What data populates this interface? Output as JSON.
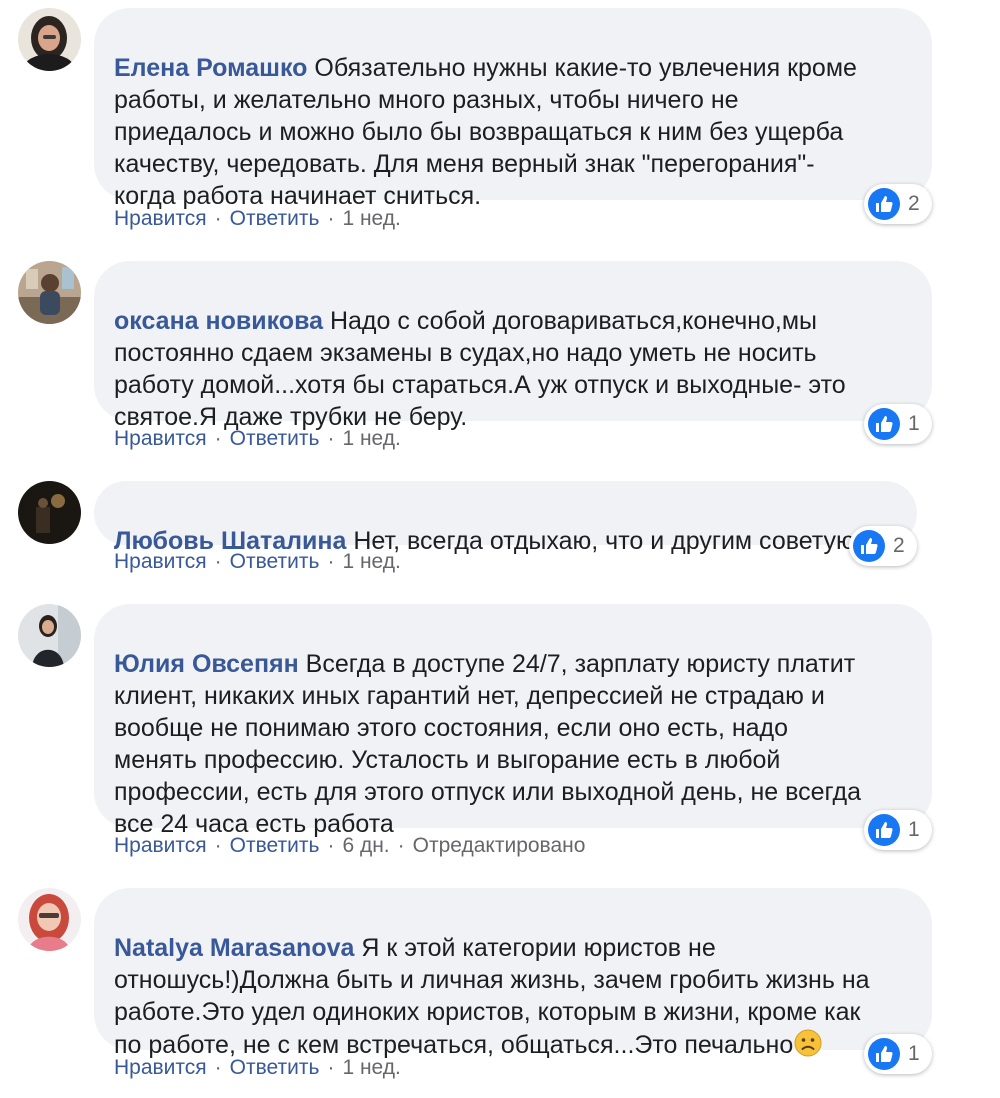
{
  "comments": [
    {
      "author": "Елена Ромашко",
      "text": " Обязательно нужны какие-то увлечения кроме\nработы, и желательно много разных, чтобы ничего не\nприедалось и можно было бы возвращаться к ним без ущерба\nкачеству, чередовать. Для меня верный знак \"перегорания\"-\nкогда работа начинает сниться.",
      "like_label": "Нравится",
      "reply_label": "Ответить",
      "time": "1 нед.",
      "reactions": "2"
    },
    {
      "author": "оксана новикова",
      "text": " Надо с собой договариваться,конечно,мы\nпостоянно сдаем экзамены в судах,но надо уметь не носить\nработу домой...хотя бы стараться.А уж отпуск и выходные- это\nсвятое.Я даже трубки не беру.",
      "like_label": "Нравится",
      "reply_label": "Ответить",
      "time": "1 нед.",
      "reactions": "1"
    },
    {
      "author": "Любовь Шаталина",
      "text": " Нет, всегда отдыхаю, что и другим советую.",
      "like_label": "Нравится",
      "reply_label": "Ответить",
      "time": "1 нед.",
      "reactions": "2"
    },
    {
      "author": "Юлия Овсепян",
      "text": " Всегда в доступе 24/7, зарплату юристу платит\nклиент, никаких иных гарантий нет, депрессией не страдаю и\nвообще не понимаю этого состояния, если оно есть, надо\nменять профессию. Усталость и выгорание есть в любой\nпрофессии, есть для этого отпуск или выходной день, не всегда\nвсе 24 часа есть работа",
      "like_label": "Нравится",
      "reply_label": "Ответить",
      "time": "6 дн.",
      "edited": "Отредактировано",
      "reactions": "1"
    },
    {
      "author": "Natalya Marasanova",
      "text": " Я к этой категории юристов не\nотношусь!)Должна быть и личная жизнь, зачем гробить жизнь на\nработе.Это удел одиноких юристов, которым в жизни, кроме как\nпо работе, не с кем встречаться, общаться...Это печально",
      "like_label": "Нравится",
      "reply_label": "Ответить",
      "time": "1 нед.",
      "reactions": "1"
    }
  ],
  "icons": {
    "reaction": "like-icon",
    "inline_emoji": "sad-face-emoji"
  },
  "colors": {
    "link": "#385898",
    "bubble": "#f0f2f5",
    "like": "#1877f2"
  }
}
